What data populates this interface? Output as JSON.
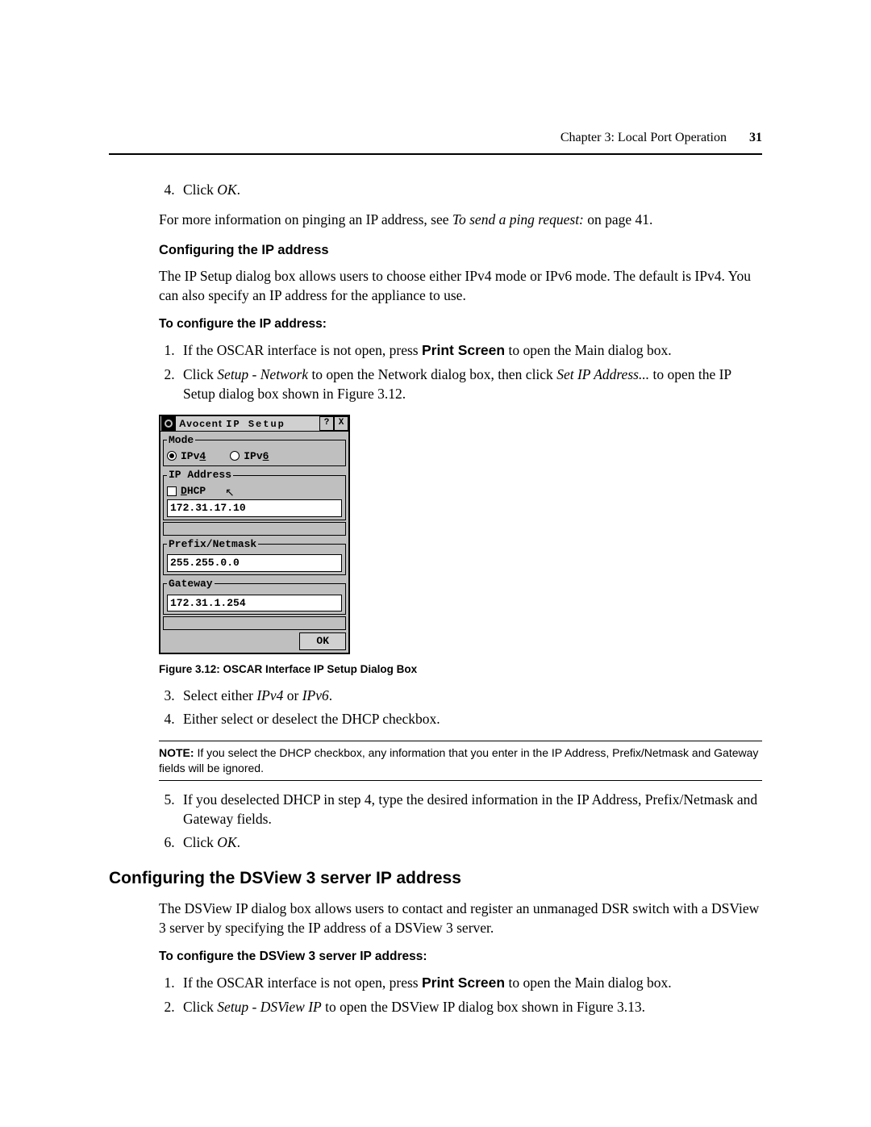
{
  "header": {
    "chapter": "Chapter 3: Local Port Operation",
    "page": "31"
  },
  "steps_top": {
    "start": 4,
    "items": [
      {
        "prefix": "Click ",
        "em": "OK",
        "suffix": "."
      }
    ]
  },
  "p_ping": {
    "a": "For more information on pinging an IP address, see ",
    "em": "To send a ping request:",
    "b": " on page 41."
  },
  "h_config_ip": "Configuring the IP address",
  "p_ipsetup": "The IP Setup dialog box allows users to choose either IPv4 mode or IPv6 mode. The default is IPv4. You can also specify an IP address for the appliance to use.",
  "h_to_config_ip": "To configure the IP address:",
  "steps_cfg": {
    "start": 1,
    "items": [
      {
        "a": "If the OSCAR interface is not open, press ",
        "bold": "Print Screen",
        "b": " to open the Main dialog box."
      },
      {
        "a": "Click ",
        "em1": "Setup - Network",
        "b": " to open the Network dialog box, then click ",
        "em2": "Set IP Address...",
        "c": " to open the IP Setup dialog box shown in Figure 3.12."
      }
    ]
  },
  "dialog": {
    "brand": "Avocent",
    "title": "IP Setup",
    "help": "?",
    "close": "X",
    "mode_legend": "Mode",
    "ipv4_pre": "IPv",
    "ipv4_u": "4",
    "ipv6_pre": "IPv",
    "ipv6_u": "6",
    "ipaddr_legend": "IP Address",
    "dhcp_pre": "",
    "dhcp_u": "D",
    "dhcp_post": "HCP",
    "ip_value": "172.31.17.10",
    "prefix_legend": "Prefix/Netmask",
    "netmask_value": "255.255.0.0",
    "gateway_legend": "Gateway",
    "gateway_value": "172.31.1.254",
    "ok": "OK"
  },
  "fig_caption": "Figure 3.12: OSCAR Interface IP Setup Dialog Box",
  "steps_after": {
    "start": 3,
    "items": [
      {
        "a": "Select either ",
        "em1": "IPv4",
        "b": " or ",
        "em2": "IPv6",
        "c": "."
      },
      {
        "text": "Either select or deselect the DHCP checkbox."
      }
    ]
  },
  "note": {
    "label": "NOTE:",
    "text": " If you select the DHCP checkbox, any information that you enter in the IP Address, Prefix/Netmask and Gateway fields will be ignored."
  },
  "steps_after2": {
    "start": 5,
    "items": [
      {
        "text": "If you deselected DHCP in step 4, type the desired information in the IP Address, Prefix/Netmask and Gateway fields."
      },
      {
        "a": "Click ",
        "em": "OK",
        "b": "."
      }
    ]
  },
  "h2_dsview": "Configuring the DSView 3 server IP address",
  "p_dsview": "The DSView IP dialog box allows users to contact and register an unmanaged DSR switch with a DSView 3 server by specifying the IP address of a DSView 3 server.",
  "h_to_config_dsview": "To configure the DSView 3 server IP address:",
  "steps_dsview": {
    "start": 1,
    "items": [
      {
        "a": "If the OSCAR interface is not open, press ",
        "bold": "Print Screen",
        "b": " to open the Main dialog box."
      },
      {
        "a": "Click ",
        "em": "Setup - DSView IP",
        "b": " to open the DSView IP dialog box shown in Figure 3.13."
      }
    ]
  }
}
